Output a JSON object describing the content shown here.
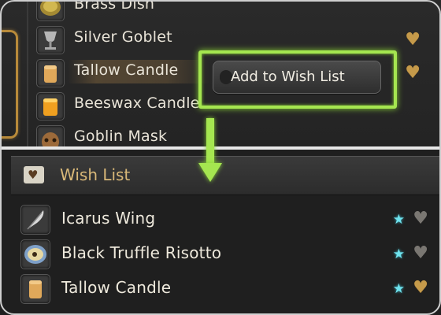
{
  "item_list": {
    "items": [
      {
        "label": "Brass Dish",
        "icon": "brass-dish-icon",
        "favorite": false
      },
      {
        "label": "Silver Goblet",
        "icon": "goblet-icon",
        "favorite": true
      },
      {
        "label": "Tallow Candle",
        "icon": "candle-icon",
        "favorite": true,
        "selected": true
      },
      {
        "label": "Beeswax Candle",
        "icon": "beeswax-candle-icon",
        "favorite": false
      },
      {
        "label": "Goblin Mask",
        "icon": "goblin-mask-icon",
        "favorite": false
      }
    ]
  },
  "context_menu": {
    "option": "Add to Wish List"
  },
  "wish_list": {
    "title": "Wish List",
    "items": [
      {
        "label": "Icarus Wing",
        "icon": "feather-icon",
        "starred": true,
        "favorite": false
      },
      {
        "label": "Black Truffle Risotto",
        "icon": "risotto-icon",
        "starred": true,
        "favorite": false
      },
      {
        "label": "Tallow Candle",
        "icon": "candle-icon",
        "starred": true,
        "favorite": true
      }
    ]
  },
  "colors": {
    "highlight_green": "#a5e650",
    "heart_gold": "#c59a4a",
    "heart_grey": "#7a7772",
    "star_cyan": "#6fe3ee",
    "header_text": "#d9b878"
  }
}
